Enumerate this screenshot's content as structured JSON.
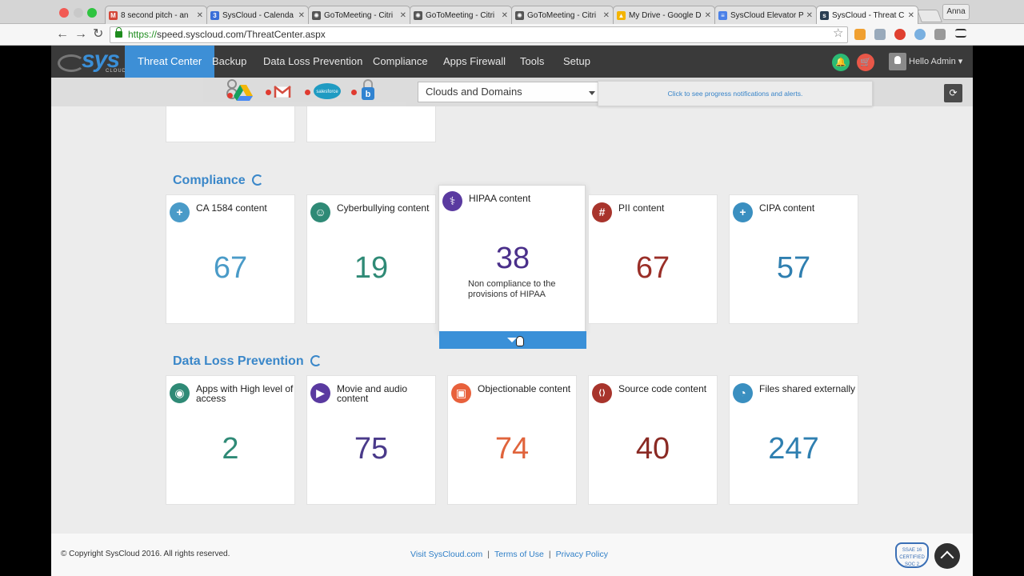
{
  "browser": {
    "tabs": [
      {
        "title": "8 second pitch - an",
        "favicon_color": "#d44638",
        "favicon_text": "M",
        "active": false
      },
      {
        "title": "SysCloud - Calenda",
        "favicon_color": "#3a6fd8",
        "favicon_text": "3",
        "active": false
      },
      {
        "title": "GoToMeeting - Citri",
        "favicon_color": "#555555",
        "favicon_text": "✺",
        "active": false
      },
      {
        "title": "GoToMeeting - Citri",
        "favicon_color": "#555555",
        "favicon_text": "✺",
        "active": false
      },
      {
        "title": "GoToMeeting - Citri",
        "favicon_color": "#555555",
        "favicon_text": "✺",
        "active": false
      },
      {
        "title": "My Drive - Google D",
        "favicon_color": "#f4b400",
        "favicon_text": "▲",
        "active": false
      },
      {
        "title": "SysCloud Elevator P",
        "favicon_color": "#4a80e8",
        "favicon_text": "≡",
        "active": false
      },
      {
        "title": "SysCloud - Threat C",
        "favicon_color": "#2b3f52",
        "favicon_text": "s",
        "active": true
      }
    ],
    "tab_close": "✕",
    "profile": "Anna",
    "url_scheme": "https://",
    "url_rest": "speed.syscloud.com/ThreatCenter.aspx",
    "back_icon": "←",
    "forward_icon": "→",
    "reload_icon": "↻",
    "star_icon": "☆"
  },
  "app": {
    "logo_text": "sys",
    "logo_sub": "CLOUD",
    "nav": [
      "Threat Center",
      "Backup",
      "Data Loss Prevention",
      "Compliance",
      "Apps Firewall",
      "Tools",
      "Setup"
    ],
    "bell_icon": "🔔",
    "cart_icon": "🛒",
    "greeting": "Hello Admin ▾",
    "select_value": "Clouds and Domains",
    "notification_text": "Click to see progress notifications and alerts.",
    "refresh_icon": "⟳",
    "salesforce_label": "salesforce"
  },
  "colors": {
    "accent": "#3d8fd6",
    "teal": "#3a8a7a",
    "purple": "#5a3a9a",
    "red": "#a8322a",
    "blue": "#3a8fb8",
    "orange": "#e8613c"
  },
  "compliance": {
    "title": "Compliance",
    "cards": [
      {
        "label": "CA 1584 content",
        "value": "67",
        "icon": "+",
        "icon_color": "#4a9bc8",
        "value_color": "#4a9bc8"
      },
      {
        "label": "Cyberbullying content",
        "value": "19",
        "icon": "☺",
        "icon_color": "#2f8a76",
        "value_color": "#2f8a76"
      },
      {
        "label": "HIPAA content",
        "value": "38",
        "icon": "⚕",
        "icon_color": "#5a3aa0",
        "value_color": "#4a2f8a",
        "description": "Non compliance to the provisions of HIPAA"
      },
      {
        "label": "PII content",
        "value": "67",
        "icon": "#",
        "icon_color": "#a8342c",
        "value_color": "#9a2f28"
      },
      {
        "label": "CIPA content",
        "value": "57",
        "icon": "+",
        "icon_color": "#3a8fc0",
        "value_color": "#2f7fb0"
      }
    ]
  },
  "dlp": {
    "title": "Data Loss Prevention",
    "cards": [
      {
        "label": "Apps with High level of access",
        "value": "2",
        "icon": "◉",
        "icon_color": "#2f8a76",
        "value_color": "#2f8a76"
      },
      {
        "label": "Movie and audio content",
        "value": "75",
        "icon": "▶",
        "icon_color": "#5a3aa0",
        "value_color": "#4a3a8a"
      },
      {
        "label": "Objectionable content",
        "value": "74",
        "icon": "▣",
        "icon_color": "#e8613c",
        "value_color": "#e0643c"
      },
      {
        "label": "Source code content",
        "value": "40",
        "icon": "⟨⟩",
        "icon_color": "#a8342c",
        "value_color": "#8a2a24"
      },
      {
        "label": "Files shared externally",
        "value": "247",
        "icon": "◔",
        "icon_color": "#3a8fc0",
        "value_color": "#2f7fb0"
      }
    ]
  },
  "footer": {
    "copyright": "© Copyright SysCloud 2016. All rights reserved.",
    "link_visit": "Visit SysCloud.com",
    "link_terms": "Terms of Use",
    "link_privacy": "Privacy Policy",
    "separator": "|",
    "badge_text": "SSAE 16 CERTIFIED SOC 2"
  }
}
